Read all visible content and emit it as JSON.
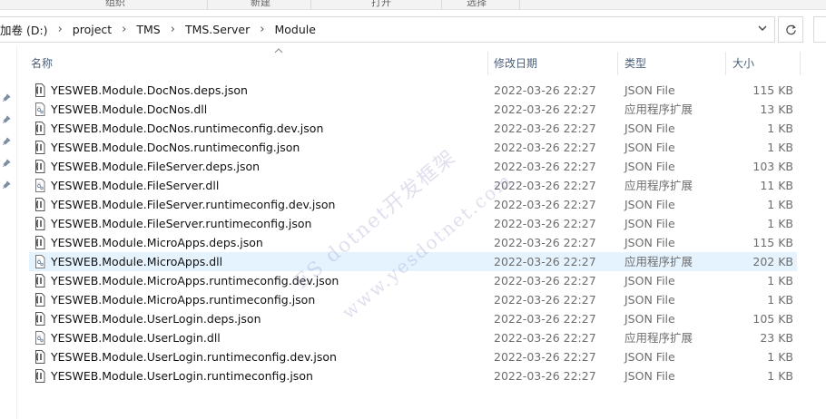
{
  "ribbon": {
    "groups": [
      "组织",
      "新建",
      "打开",
      "选择"
    ]
  },
  "address": {
    "crumbs": [
      "加卷 (D:)",
      "project",
      "TMS",
      "TMS.Server",
      "Module"
    ],
    "dropdown_icon": "chevron-down-icon",
    "refresh_icon": "refresh-icon"
  },
  "columns": {
    "name": "名称",
    "date": "修改日期",
    "type": "类型",
    "size": "大小"
  },
  "files": [
    {
      "name": "YESWEB.Module.DocNos.deps.json",
      "date": "2022-03-26 22:27",
      "type": "JSON File",
      "size": "115 KB",
      "icon": "json-file-icon"
    },
    {
      "name": "YESWEB.Module.DocNos.dll",
      "date": "2022-03-26 22:27",
      "type": "应用程序扩展",
      "size": "13 KB",
      "icon": "dll-file-icon"
    },
    {
      "name": "YESWEB.Module.DocNos.runtimeconfig.dev.json",
      "date": "2022-03-26 22:27",
      "type": "JSON File",
      "size": "1 KB",
      "icon": "json-file-icon"
    },
    {
      "name": "YESWEB.Module.DocNos.runtimeconfig.json",
      "date": "2022-03-26 22:27",
      "type": "JSON File",
      "size": "1 KB",
      "icon": "json-file-icon"
    },
    {
      "name": "YESWEB.Module.FileServer.deps.json",
      "date": "2022-03-26 22:27",
      "type": "JSON File",
      "size": "103 KB",
      "icon": "json-file-icon"
    },
    {
      "name": "YESWEB.Module.FileServer.dll",
      "date": "2022-03-26 22:27",
      "type": "应用程序扩展",
      "size": "11 KB",
      "icon": "dll-file-icon"
    },
    {
      "name": "YESWEB.Module.FileServer.runtimeconfig.dev.json",
      "date": "2022-03-26 22:27",
      "type": "JSON File",
      "size": "1 KB",
      "icon": "json-file-icon"
    },
    {
      "name": "YESWEB.Module.FileServer.runtimeconfig.json",
      "date": "2022-03-26 22:27",
      "type": "JSON File",
      "size": "1 KB",
      "icon": "json-file-icon"
    },
    {
      "name": "YESWEB.Module.MicroApps.deps.json",
      "date": "2022-03-26 22:27",
      "type": "JSON File",
      "size": "115 KB",
      "icon": "json-file-icon"
    },
    {
      "name": "YESWEB.Module.MicroApps.dll",
      "date": "2022-03-26 22:27",
      "type": "应用程序扩展",
      "size": "202 KB",
      "icon": "dll-file-icon",
      "selected": true
    },
    {
      "name": "YESWEB.Module.MicroApps.runtimeconfig.dev.json",
      "date": "2022-03-26 22:27",
      "type": "JSON File",
      "size": "1 KB",
      "icon": "json-file-icon"
    },
    {
      "name": "YESWEB.Module.MicroApps.runtimeconfig.json",
      "date": "2022-03-26 22:27",
      "type": "JSON File",
      "size": "1 KB",
      "icon": "json-file-icon"
    },
    {
      "name": "YESWEB.Module.UserLogin.deps.json",
      "date": "2022-03-26 22:27",
      "type": "JSON File",
      "size": "105 KB",
      "icon": "json-file-icon"
    },
    {
      "name": "YESWEB.Module.UserLogin.dll",
      "date": "2022-03-26 22:27",
      "type": "应用程序扩展",
      "size": "23 KB",
      "icon": "dll-file-icon"
    },
    {
      "name": "YESWEB.Module.UserLogin.runtimeconfig.dev.json",
      "date": "2022-03-26 22:27",
      "type": "JSON File",
      "size": "1 KB",
      "icon": "json-file-icon"
    },
    {
      "name": "YESWEB.Module.UserLogin.runtimeconfig.json",
      "date": "2022-03-26 22:27",
      "type": "JSON File",
      "size": "1 KB",
      "icon": "json-file-icon"
    }
  ],
  "watermark": {
    "line1": "ES dotnet开发框架",
    "line2": "www.yesdotnet.com"
  },
  "colors": {
    "selected_row": "#e5f3ff",
    "header_text": "#4c607a",
    "secondary_text": "#6d6d6d"
  }
}
